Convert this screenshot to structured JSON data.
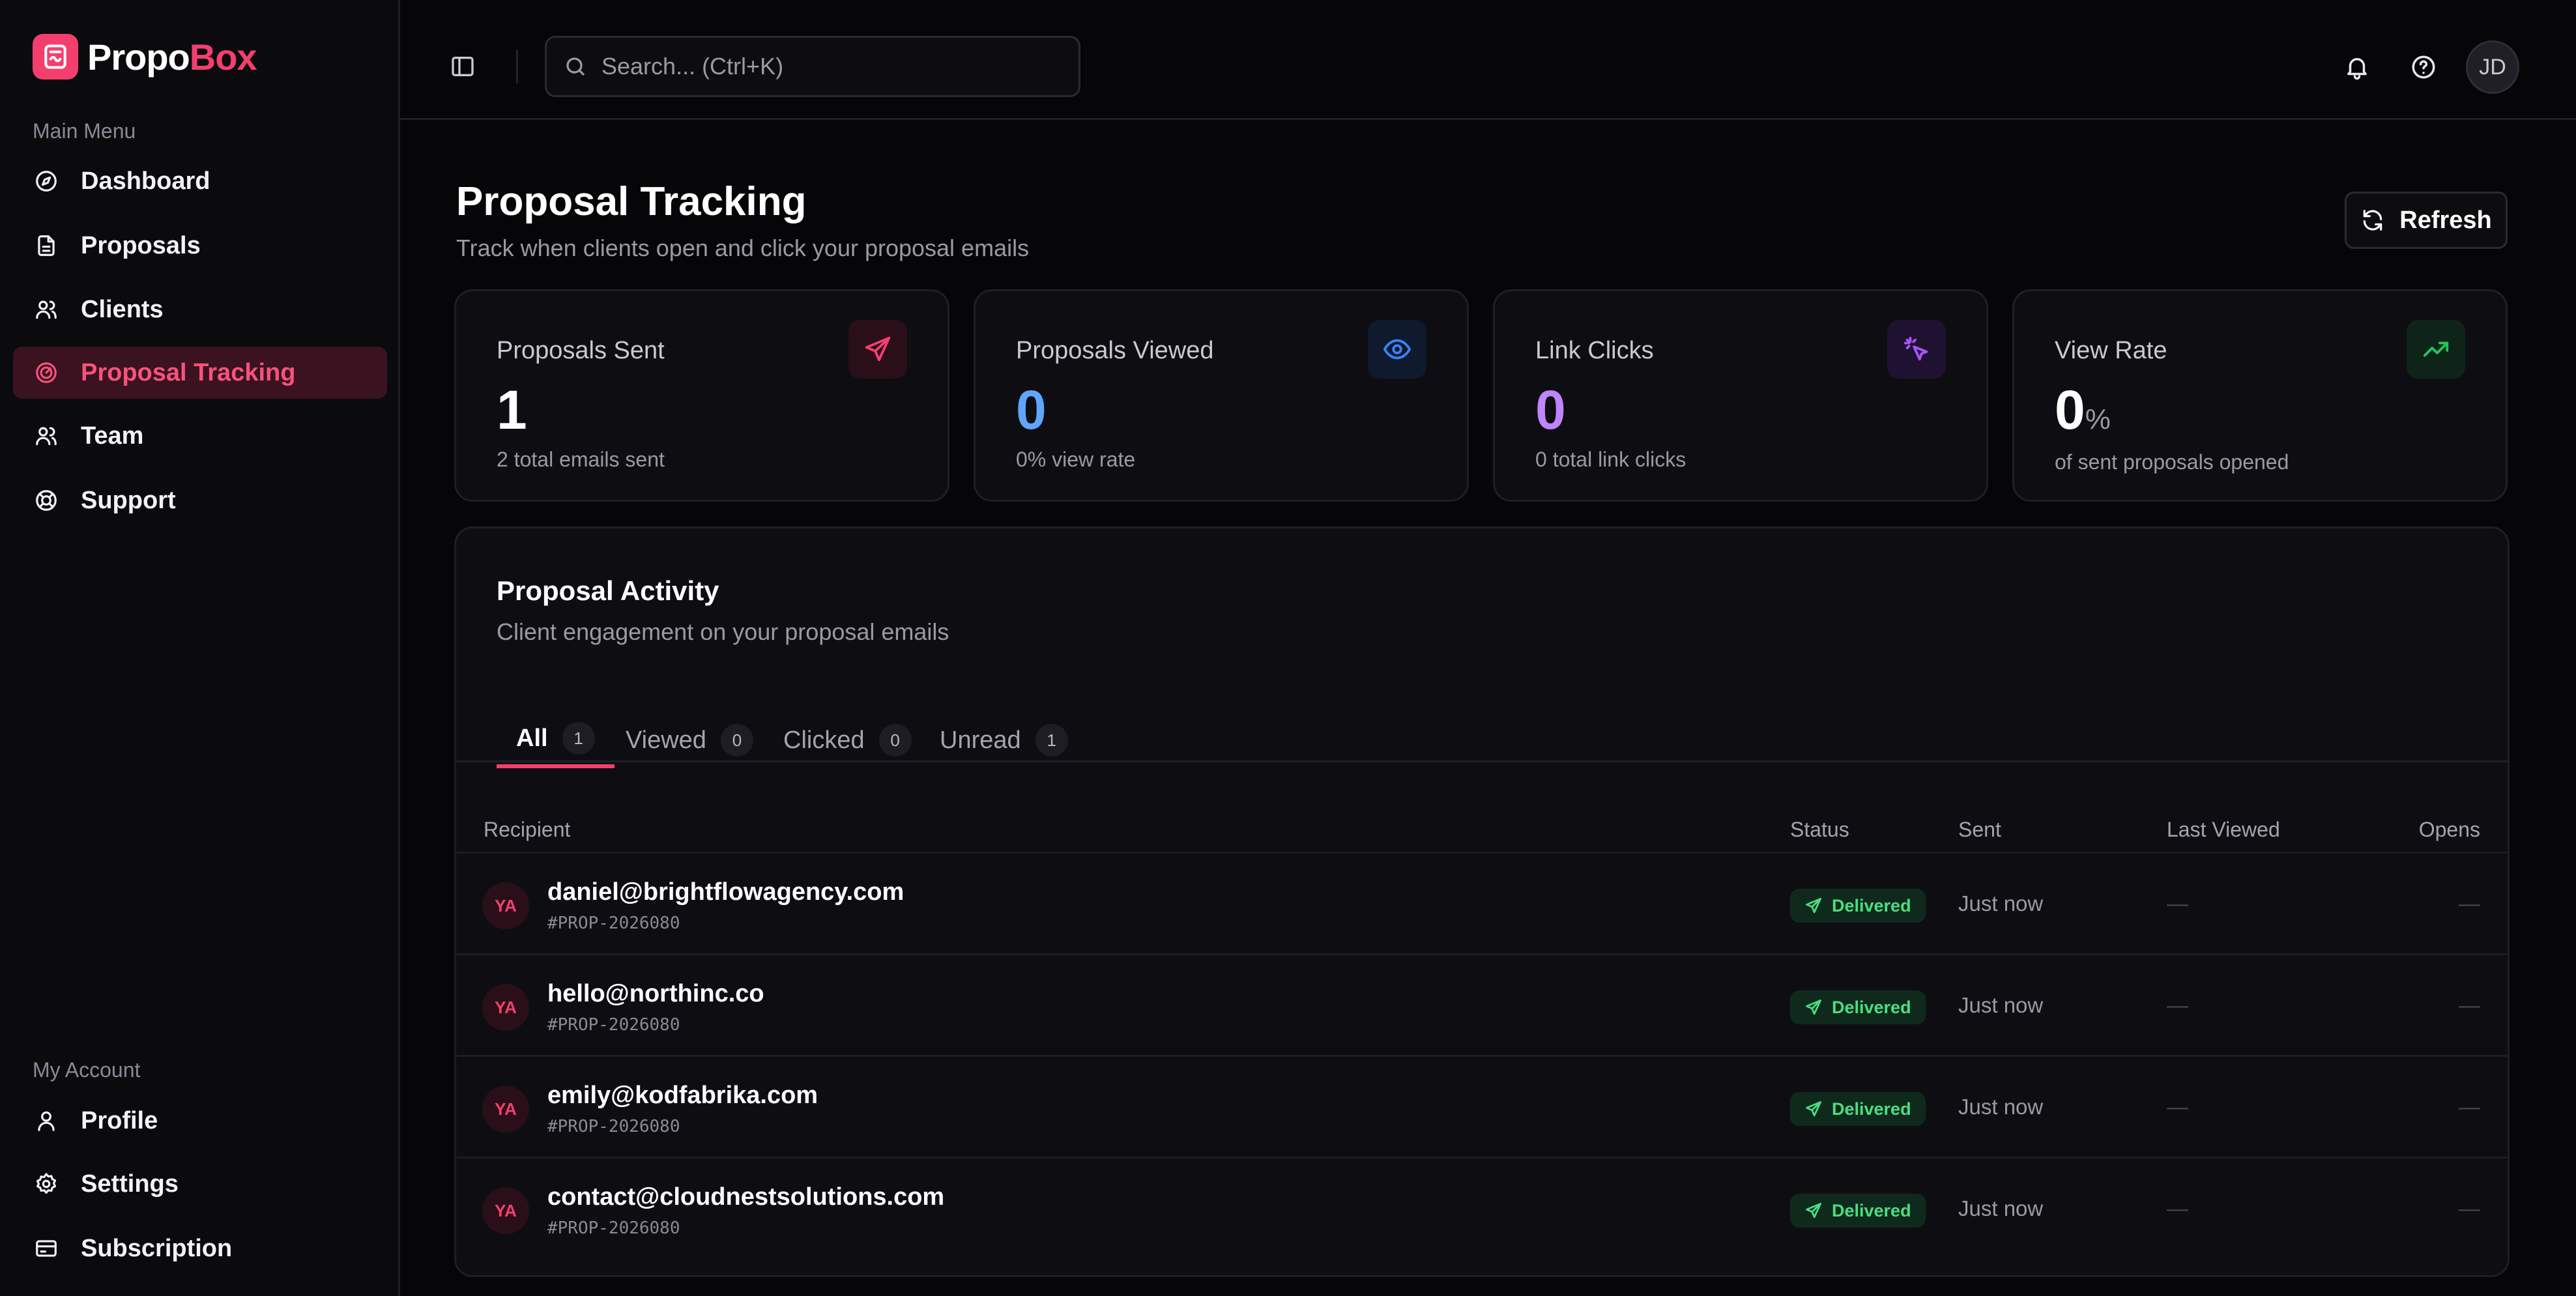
{
  "brand": {
    "name_a": "Propo",
    "name_b": "Box",
    "accent": "#f43f6e"
  },
  "sidebar": {
    "main_label": "Main Menu",
    "main_items": [
      {
        "label": "Dashboard",
        "icon": "compass-icon"
      },
      {
        "label": "Proposals",
        "icon": "document-icon"
      },
      {
        "label": "Clients",
        "icon": "users-icon"
      },
      {
        "label": "Proposal Tracking",
        "icon": "tracking-icon",
        "active": true
      },
      {
        "label": "Team",
        "icon": "team-icon"
      },
      {
        "label": "Support",
        "icon": "lifebuoy-icon"
      }
    ],
    "account_label": "My Account",
    "account_items": [
      {
        "label": "Profile",
        "icon": "user-icon"
      },
      {
        "label": "Settings",
        "icon": "gear-icon"
      },
      {
        "label": "Subscription",
        "icon": "card-icon"
      }
    ]
  },
  "topbar": {
    "search_placeholder": "Search... (Ctrl+K)",
    "user_initials": "JD"
  },
  "page": {
    "title": "Proposal Tracking",
    "subtitle": "Track when clients open and click your proposal emails",
    "refresh_label": "Refresh"
  },
  "stats": [
    {
      "label": "Proposals Sent",
      "value": "1",
      "unit": "",
      "foot": "2 total emails sent",
      "color": "#ffffff",
      "icon": "send-icon",
      "icon_color": "#f43f6e",
      "icon_bg": "#2a0f19"
    },
    {
      "label": "Proposals Viewed",
      "value": "0",
      "unit": "",
      "foot": "0% view rate",
      "color": "#60a5fa",
      "icon": "eye-icon",
      "icon_color": "#3b82f6",
      "icon_bg": "#0f1a2e"
    },
    {
      "label": "Link Clicks",
      "value": "0",
      "unit": "",
      "foot": "0 total link clicks",
      "color": "#c084fc",
      "icon": "cursor-click-icon",
      "icon_color": "#a855f7",
      "icon_bg": "#1f1230"
    },
    {
      "label": "View Rate",
      "value": "0",
      "unit": "%",
      "foot": "of sent proposals opened",
      "color": "#ffffff",
      "icon": "trending-up-icon",
      "icon_color": "#22c55e",
      "icon_bg": "#0e2419"
    }
  ],
  "activity": {
    "title": "Proposal Activity",
    "subtitle": "Client engagement on your proposal emails",
    "tabs": [
      {
        "label": "All",
        "count": "1",
        "active": true
      },
      {
        "label": "Viewed",
        "count": "0"
      },
      {
        "label": "Clicked",
        "count": "0"
      },
      {
        "label": "Unread",
        "count": "1"
      }
    ],
    "columns": {
      "recipient": "Recipient",
      "status": "Status",
      "sent": "Sent",
      "last_viewed": "Last Viewed",
      "opens": "Opens"
    },
    "rows": [
      {
        "initials": "YA",
        "email": "daniel@brightflowagency.com",
        "id": "#PROP-2026080",
        "status": "Delivered",
        "sent": "Just now",
        "last_viewed": "—",
        "opens": "—"
      },
      {
        "initials": "YA",
        "email": "hello@northinc.co",
        "id": "#PROP-2026080",
        "status": "Delivered",
        "sent": "Just now",
        "last_viewed": "—",
        "opens": "—"
      },
      {
        "initials": "YA",
        "email": "emily@kodfabrika.com",
        "id": "#PROP-2026080",
        "status": "Delivered",
        "sent": "Just now",
        "last_viewed": "—",
        "opens": "—"
      },
      {
        "initials": "YA",
        "email": "contact@cloudnestsolutions.com",
        "id": "#PROP-2026080",
        "status": "Delivered",
        "sent": "Just now",
        "last_viewed": "—",
        "opens": "—"
      }
    ]
  }
}
